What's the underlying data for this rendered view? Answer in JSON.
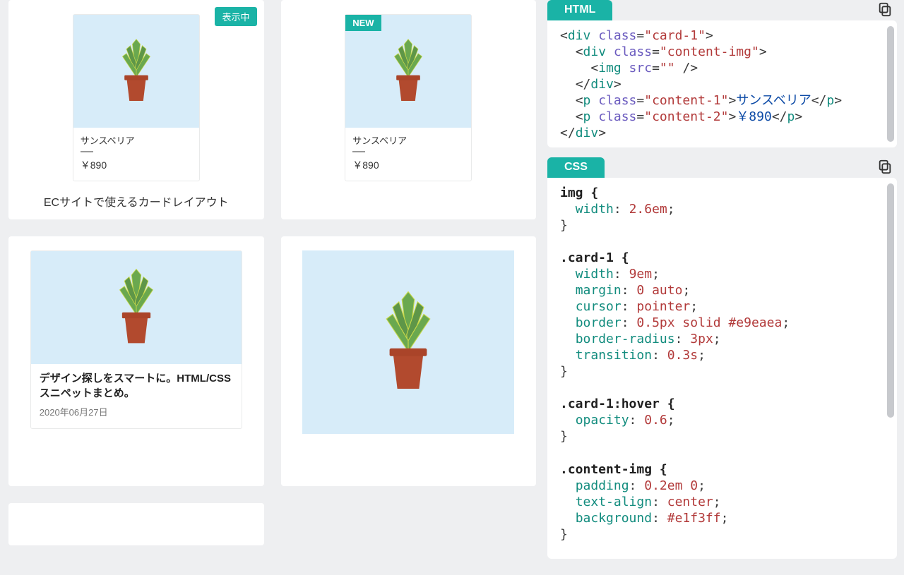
{
  "left": {
    "showing_badge": "表示中",
    "ec": {
      "name": "サンスベリア",
      "price": "￥890",
      "new_ribbon": "NEW",
      "caption": "ECサイトで使えるカードレイアウト"
    },
    "blog": {
      "title": "デザイン探しをスマートに。HTML/CSSスニペットまとめ。",
      "date": "2020年06月27日"
    }
  },
  "right": {
    "html_label": "HTML",
    "css_label": "CSS",
    "code_html": {
      "l1_open": "<div",
      "l1_a": " class",
      "l1_eq": "=",
      "l1_v": "\"card-1\"",
      "l1_close": ">",
      "l2_open": "<div",
      "l2_a": " class",
      "l2_eq": "=",
      "l2_v": "\"content-img\"",
      "l2_close": ">",
      "l3_open": "<img",
      "l3_a": " src",
      "l3_eq": "=",
      "l3_v": "\"\"",
      "l3_close": " />",
      "l4": "</div>",
      "l5_open": "<p",
      "l5_a": " class",
      "l5_eq": "=",
      "l5_v": "\"content-1\"",
      "l5_mid": ">",
      "l5_txt": "サンスベリア",
      "l5_end": "</p>",
      "l6_open": "<p",
      "l6_a": " class",
      "l6_eq": "=",
      "l6_v": "\"content-2\"",
      "l6_mid": ">",
      "l6_txt": "￥890",
      "l6_end": "</p>",
      "l7": "</div>"
    },
    "code_css": {
      "r1": "img {",
      "r2p": "width",
      "r2v": "2.6em",
      "r3": "}",
      "r4": ".card-1 {",
      "r5p": "width",
      "r5v": "9em",
      "r6p": "margin",
      "r6v": "0 auto",
      "r7p": "cursor",
      "r7v": "pointer",
      "r8p": "border",
      "r8v": "0.5px solid #e9eaea",
      "r9p": "border-radius",
      "r9v": "3px",
      "r10p": "transition",
      "r10v": "0.3s",
      "r11": "}",
      "r12": ".card-1:hover {",
      "r13p": "opacity",
      "r13v": "0.6",
      "r14": "}",
      "r15": ".content-img {",
      "r16p": "padding",
      "r16v": "0.2em 0",
      "r17p": "text-align",
      "r17v": "center",
      "r18p": "background",
      "r18v": "#e1f3ff",
      "r19": "}"
    }
  }
}
